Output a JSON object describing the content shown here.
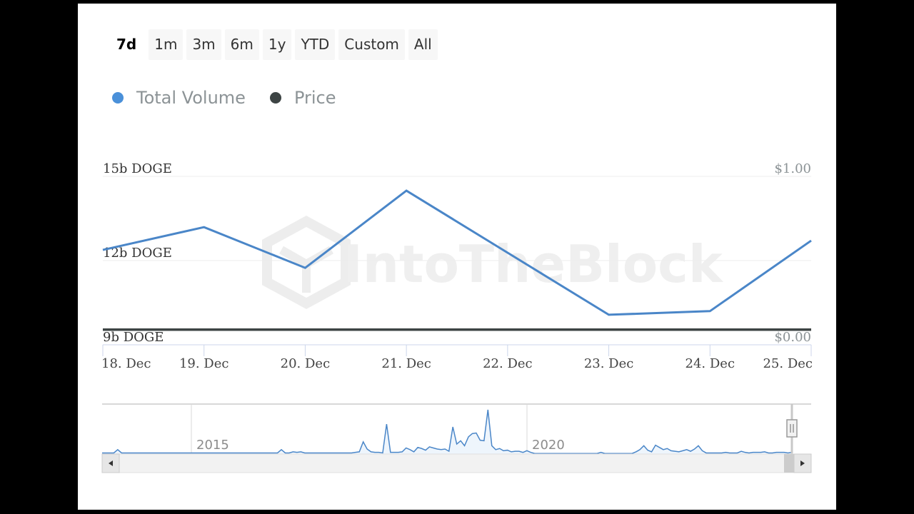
{
  "range_selector": {
    "buttons": [
      "7d",
      "1m",
      "3m",
      "6m",
      "1y",
      "YTD",
      "Custom",
      "All"
    ],
    "active": "7d"
  },
  "legend": [
    {
      "name": "Total Volume",
      "color": "#4a90d9"
    },
    {
      "name": "Price",
      "color": "#3d4444"
    }
  ],
  "watermark": "IntoTheBlock",
  "chart_data": {
    "type": "line",
    "title": "",
    "x": [
      "18. Dec",
      "19. Dec",
      "20. Dec",
      "21. Dec",
      "22. Dec",
      "23. Dec",
      "24. Dec",
      "25. Dec"
    ],
    "series": [
      {
        "name": "Total Volume",
        "axis": "left",
        "unit": "b DOGE",
        "color": "#4a86c8",
        "values": [
          12.38,
          13.19,
          11.74,
          14.49,
          12.28,
          10.07,
          10.2,
          12.71
        ]
      },
      {
        "name": "Price",
        "axis": "right",
        "unit": "USD",
        "color": "#3d4444",
        "values": [
          0.09,
          0.09,
          0.09,
          0.09,
          0.09,
          0.09,
          0.09,
          0.09
        ]
      }
    ],
    "left_axis": {
      "ticks": [
        "9b DOGE",
        "12b DOGE",
        "15b DOGE"
      ],
      "tick_values": [
        9,
        12,
        15
      ],
      "ylim": [
        9,
        15
      ]
    },
    "right_axis": {
      "ticks": [
        "$0.00",
        "$1.00"
      ],
      "tick_values": [
        0,
        1
      ],
      "ylim": [
        0,
        1
      ]
    },
    "grid": true,
    "legend_position": "top-left",
    "navigator": {
      "labels": [
        "2015",
        "2020"
      ],
      "series": [
        0.2,
        0.2,
        0.2,
        0.2,
        0.8,
        0.2,
        0.2,
        0.2,
        0.2,
        0.2,
        0.2,
        0.2,
        0.2,
        0.2,
        0.2,
        0.2,
        0.2,
        0.2,
        0.2,
        0.2,
        0.2,
        0.2,
        0.2,
        0.2,
        0.2,
        0.2,
        0.2,
        0.2,
        0.2,
        0.2,
        0.2,
        0.2,
        0.2,
        0.2,
        0.2,
        0.2,
        0.2,
        0.2,
        0.2,
        0.2,
        0.2,
        0.2,
        0.2,
        0.2,
        0.2,
        0.2,
        0.8,
        0.2,
        0.2,
        0.4,
        0.3,
        0.4,
        0.2,
        0.2,
        0.2,
        0.2,
        0.2,
        0.2,
        0.2,
        0.2,
        0.2,
        0.2,
        0.2,
        0.2,
        0.2,
        0.3,
        0.4,
        2.2,
        0.9,
        0.4,
        0.3,
        0.3,
        0.2,
        5.4,
        0.3,
        0.3,
        0.3,
        0.4,
        1.1,
        0.8,
        0.4,
        1.2,
        1.0,
        0.7,
        1.3,
        1.1,
        0.9,
        0.8,
        0.9,
        0.5,
        4.9,
        1.8,
        2.4,
        1.5,
        3.1,
        3.7,
        3.8,
        2.5,
        2.4,
        8.0,
        1.5,
        0.8,
        1.0,
        0.6,
        0.7,
        0.4,
        0.5,
        0.5,
        0.3,
        0.6,
        0.3,
        0.1,
        0.1,
        0.1,
        0.1,
        0.1,
        0.1,
        0.1,
        0.1,
        0.1,
        0.1,
        0.1,
        0.1,
        0.1,
        0.1,
        0.1,
        0.1,
        0.1,
        0.3,
        0.1,
        0.1,
        0.1,
        0.1,
        0.1,
        0.1,
        0.1,
        0.1,
        0.4,
        0.8,
        1.5,
        0.7,
        0.4,
        1.6,
        1.2,
        0.8,
        1.0,
        0.6,
        0.5,
        0.4,
        0.6,
        0.8,
        0.5,
        0.9,
        1.5,
        0.6,
        0.2,
        0.2,
        0.2,
        0.2,
        0.2,
        0.3,
        0.2,
        0.2,
        0.2,
        0.5,
        0.3,
        0.2,
        0.3,
        0.3,
        0.3,
        0.4,
        0.2,
        0.2,
        0.3,
        0.3,
        0.3,
        0.2,
        0.3
      ]
    }
  }
}
